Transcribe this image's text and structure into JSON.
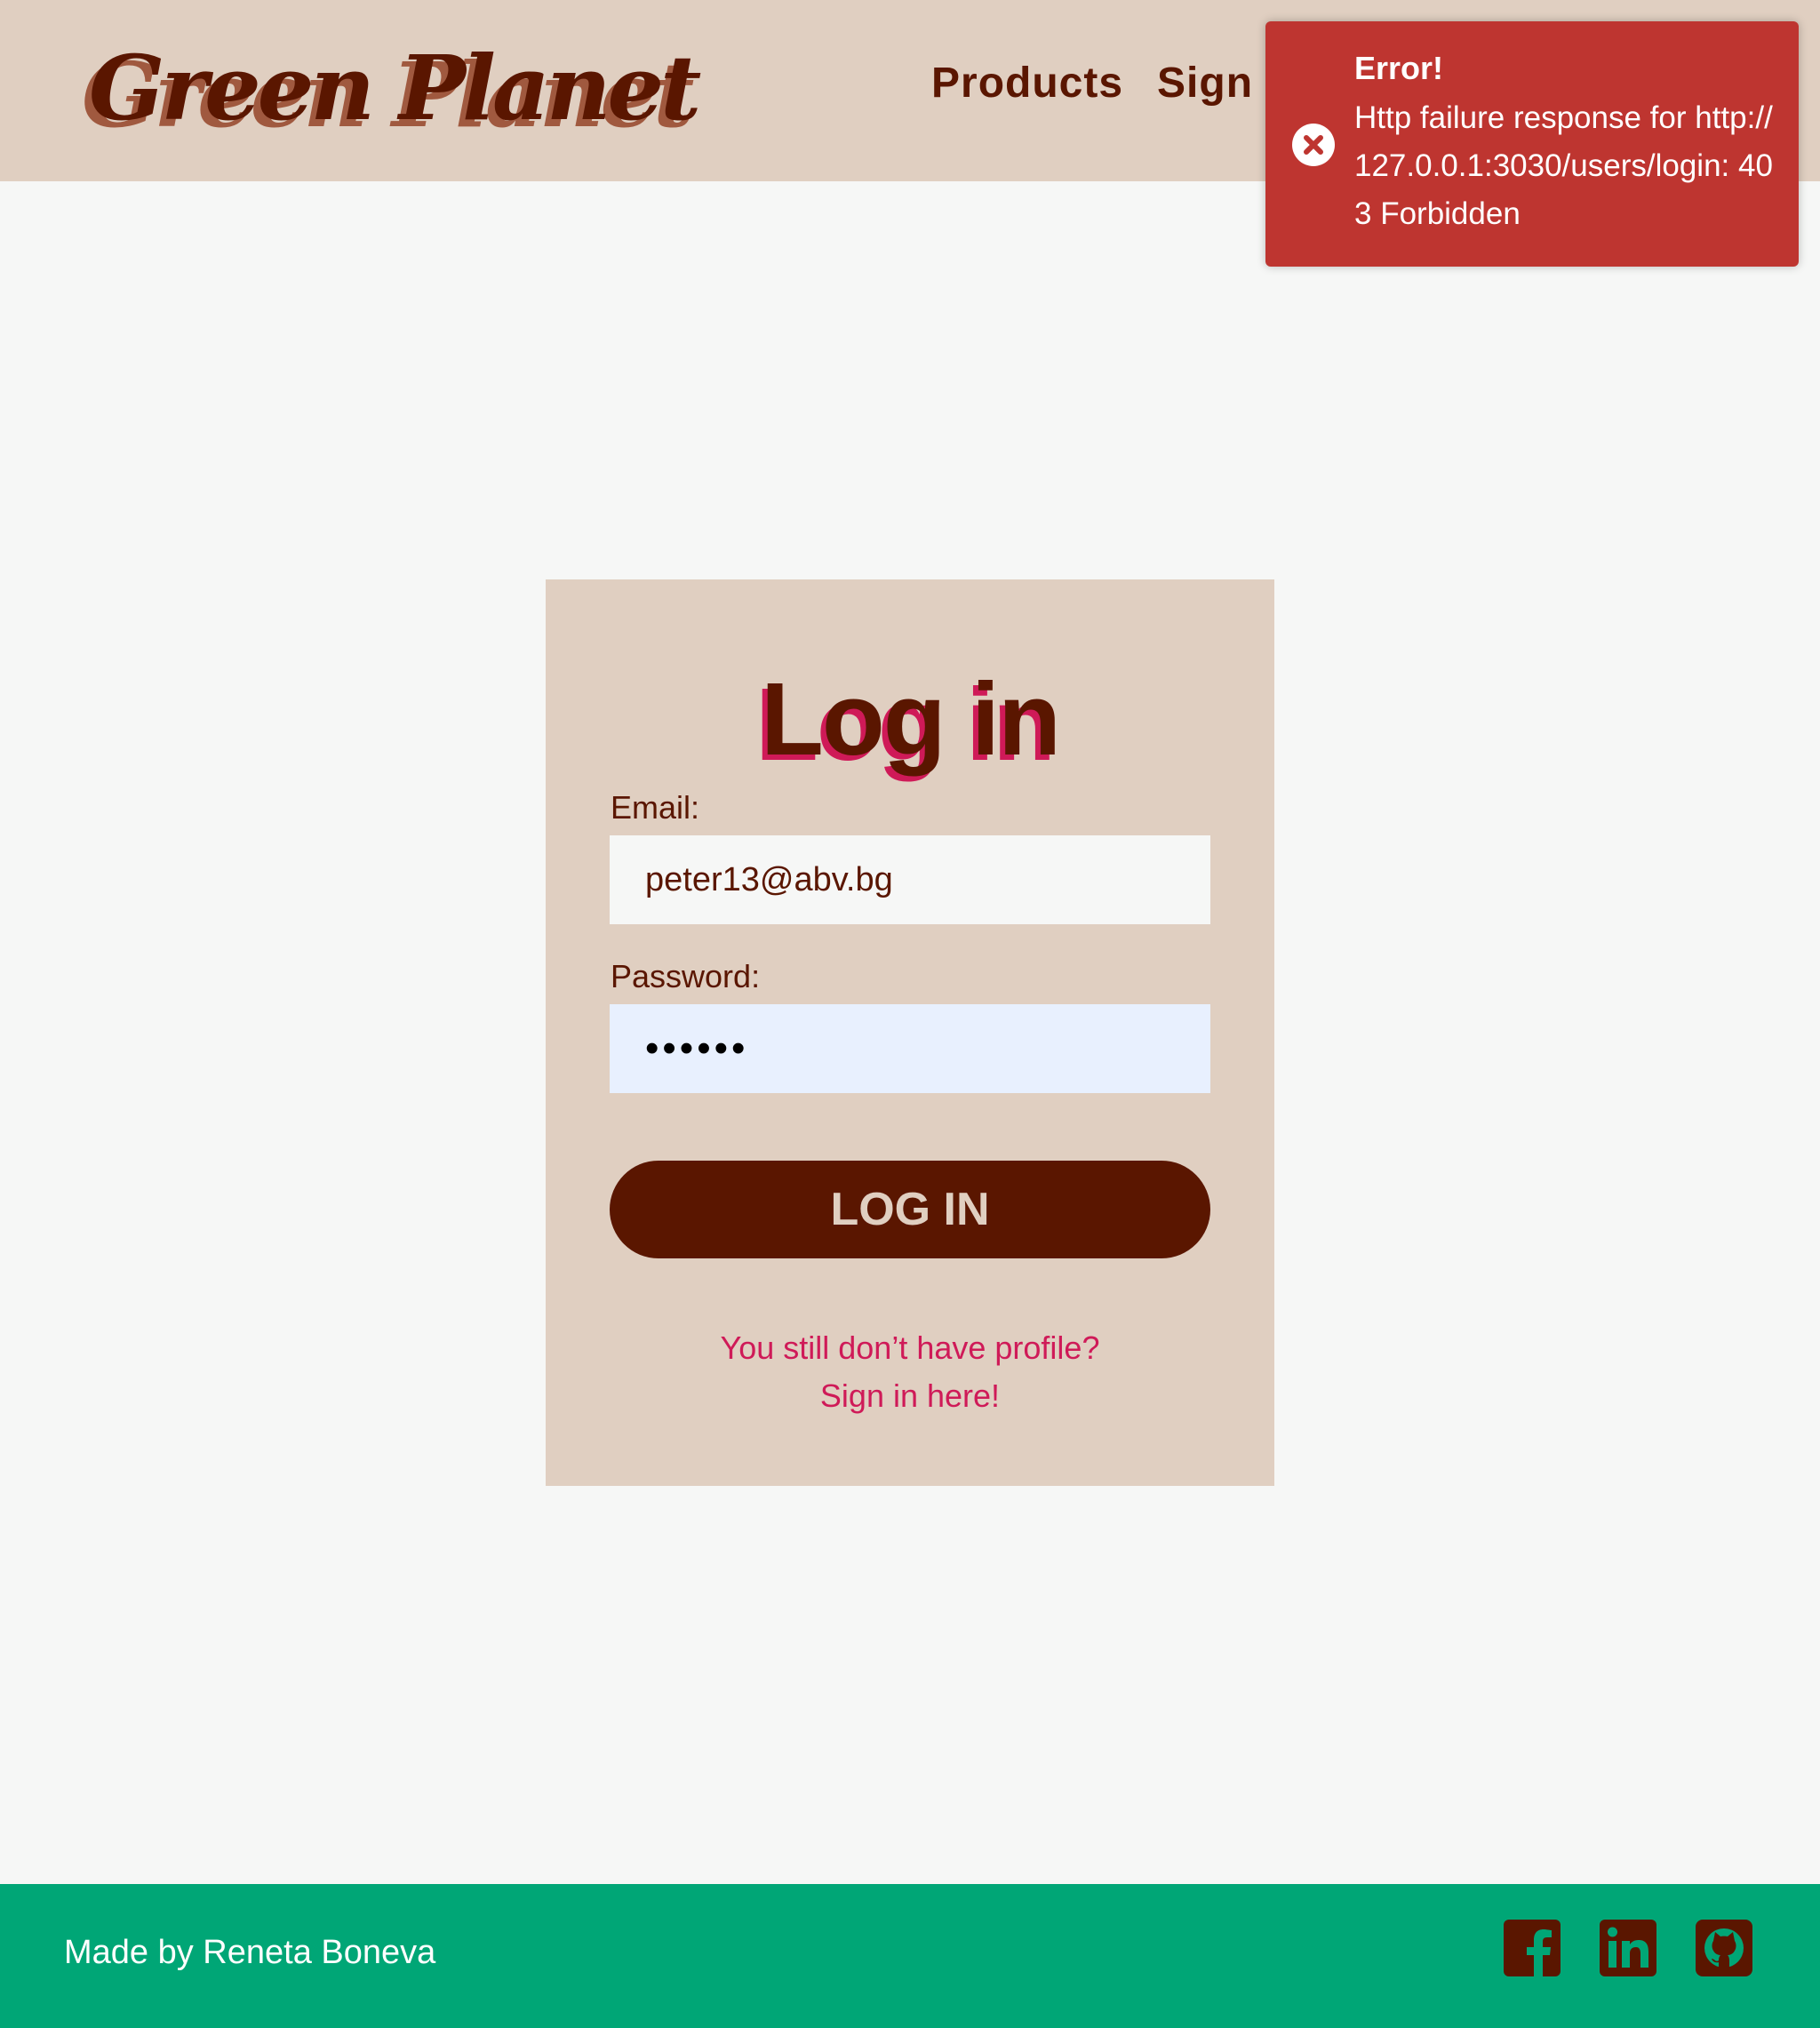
{
  "header": {
    "logo": "Green Planet",
    "nav": {
      "products": "Products",
      "sign_in": "Sign In"
    }
  },
  "toast": {
    "title": "Error!",
    "message": "Http failure response for http://127.0.0.1:3030/users/login: 403 Forbidden",
    "icon": "error-x-circle-icon"
  },
  "login": {
    "title": "Log in",
    "email_label": "Email:",
    "email_value": "peter13@abv.bg",
    "password_label": "Password:",
    "password_value": "••••••",
    "button_label": "LOG IN",
    "prompt": "You still don’t have profile?",
    "signup_link": "Sign in here!"
  },
  "footer": {
    "credit": "Made by Reneta Boneva",
    "social": [
      "facebook-icon",
      "linkedin-icon",
      "github-icon"
    ]
  },
  "colors": {
    "header_bg": "#e0cfc1",
    "brand_dark": "#5a1600",
    "accent_pink": "#cf1a58",
    "toast_bg": "#be3530",
    "footer_bg": "#00a676",
    "page_bg": "#f6f7f6"
  }
}
